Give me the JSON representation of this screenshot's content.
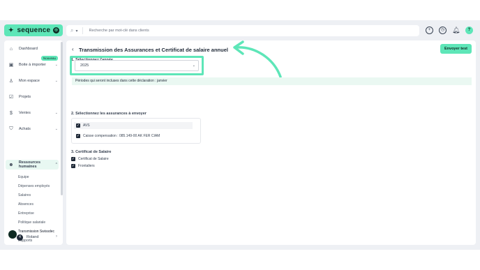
{
  "brand": {
    "name": "sequence",
    "mark": "S",
    "dot": "●"
  },
  "search": {
    "placeholder": "Recherche par mot-clé dans clients",
    "icon": "search-icon"
  },
  "topbar_icons": [
    "plus-circle-icon",
    "clock-icon",
    "bell-icon",
    "help-icon"
  ],
  "sidebar": {
    "items": [
      {
        "label": "Dashboard",
        "icon": "home-icon"
      },
      {
        "label": "Boite à importer",
        "icon": "inbox-icon",
        "badge": "Nouveau"
      },
      {
        "label": "Mon espace",
        "icon": "user-icon"
      },
      {
        "label": "Projets",
        "icon": "check-square-icon"
      },
      {
        "label": "Ventes",
        "icon": "dollar-icon"
      },
      {
        "label": "Achats",
        "icon": "cart-icon"
      },
      {
        "label": "Ressources humaines",
        "icon": "people-icon"
      }
    ],
    "subitems": [
      "Equipe",
      "Dépenses employés",
      "Salaires",
      "Absences",
      "Entreprise",
      "Politique salariale",
      "Transmission Swissdec",
      "Rapports"
    ],
    "user": {
      "name": "Roland",
      "count": "4"
    }
  },
  "main": {
    "title": "Transmission des Assurances et Certificat de salaire annuel",
    "send_button": "Envoyer test",
    "step1": {
      "label": "1. Sélectionnez l'année",
      "value": "2025"
    },
    "info": "Périodes qui seront incluses dans cette déclaration : janvier",
    "step2": {
      "label": "2. Sélectionnez les assurances à envoyer",
      "options": [
        {
          "label": "AVS",
          "checked": true
        },
        {
          "label": "Caisse compensation : 085.149-00  AK FER CIAM",
          "checked": true
        }
      ]
    },
    "step3": {
      "label": "3. Certificat de Salaire",
      "options": [
        {
          "label": "Certificat de Salaire",
          "checked": true
        },
        {
          "label": "Frontaliers",
          "checked": true
        }
      ]
    }
  },
  "colors": {
    "accent": "#5ee6b8",
    "dark": "#0e2a22"
  }
}
